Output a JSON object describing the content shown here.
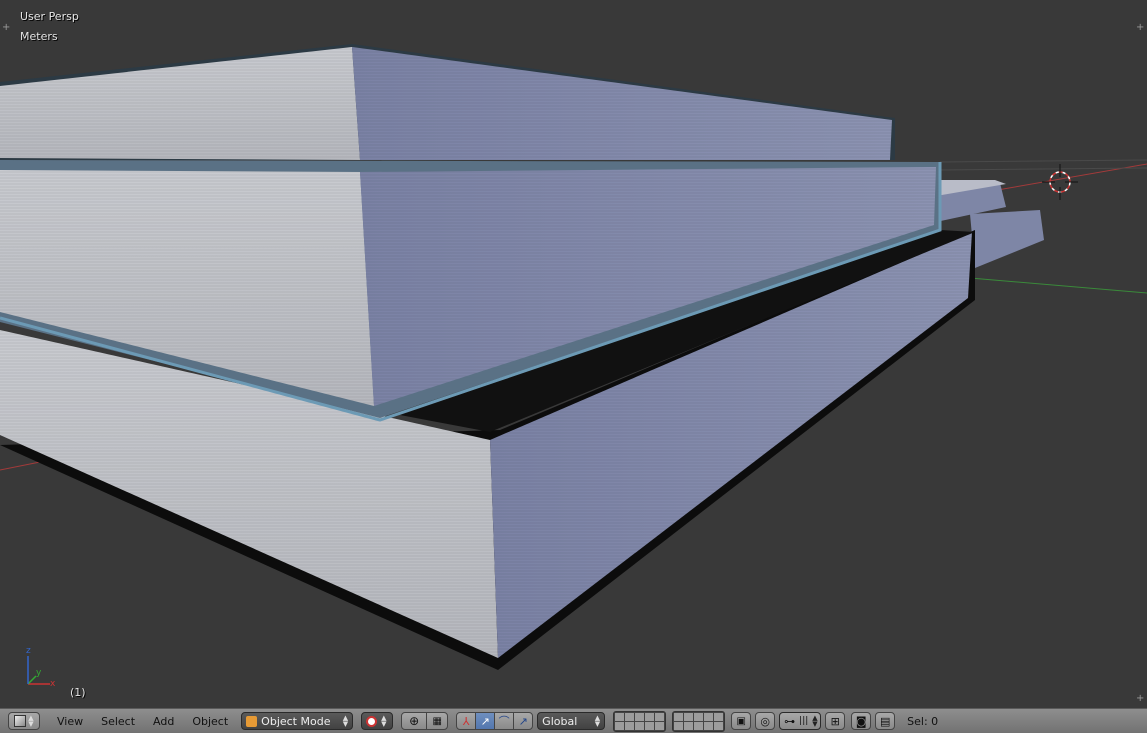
{
  "viewport": {
    "view_label": "User Persp",
    "units_label": "Meters",
    "frame_label": "(1)",
    "axis_labels": {
      "x": "x",
      "y": "y",
      "z": "z"
    }
  },
  "header": {
    "editor_type_icon": "cube-icon",
    "menus": [
      "View",
      "Select",
      "Add",
      "Object"
    ],
    "mode": "Object Mode",
    "orientation": "Global",
    "selection": "Sel: 0"
  },
  "colors": {
    "background": "#393939",
    "book_page_light": "#c6c9d2",
    "book_page_blue": "#7e86a6",
    "selection_outline": "#6c9ab5",
    "axis_red": "#a33a3a",
    "axis_green": "#3a8a3a",
    "header_bg": "#7a7a7a"
  }
}
